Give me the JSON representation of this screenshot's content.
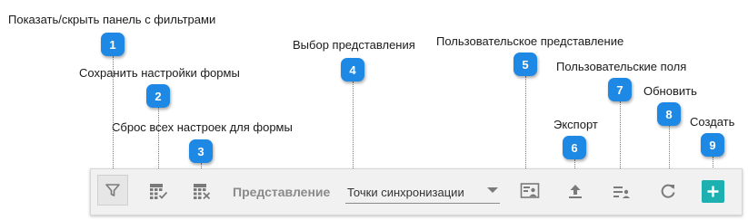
{
  "annotations": [
    {
      "num": "1",
      "label": "Показать/скрыть панель с фильтрами"
    },
    {
      "num": "2",
      "label": "Сохранить настройки формы"
    },
    {
      "num": "3",
      "label": "Сброс всех настроек для формы"
    },
    {
      "num": "4",
      "label": "Выбор представления"
    },
    {
      "num": "5",
      "label": "Пользовательское представление"
    },
    {
      "num": "6",
      "label": "Экспорт"
    },
    {
      "num": "7",
      "label": "Пользовательские поля"
    },
    {
      "num": "8",
      "label": "Обновить"
    },
    {
      "num": "9",
      "label": "Создать"
    }
  ],
  "toolbar": {
    "view_label": "Представление",
    "view_select_value": "Точки синхронизации"
  },
  "icons": {
    "filter": "filter-icon",
    "save_settings": "table-check-icon",
    "reset_settings": "table-x-icon",
    "user_view": "user-view-icon",
    "export": "upload-icon",
    "custom_fields": "list-user-icon",
    "refresh": "refresh-icon",
    "create": "plus-icon"
  },
  "colors": {
    "badge": "#1e88e5",
    "create_button": "#1cb0b0",
    "icon": "#7a7a7a"
  }
}
